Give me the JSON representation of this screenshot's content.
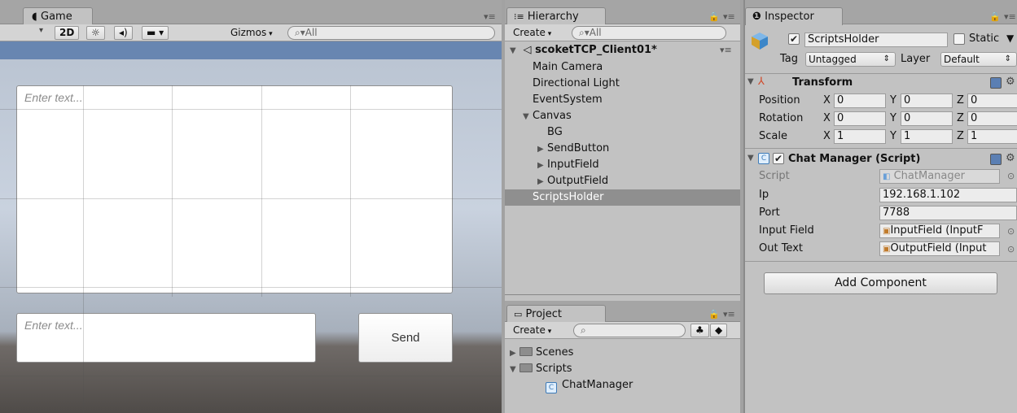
{
  "game": {
    "tab_label": "Game",
    "aspect_dropdown": "",
    "btn_2d": "2D",
    "gizmos_label": "Gizmos",
    "search_placeholder": "All",
    "output_placeholder": "Enter text...",
    "input_placeholder": "Enter text...",
    "send_label": "Send"
  },
  "hierarchy": {
    "tab_label": "Hierarchy",
    "create_label": "Create",
    "search_placeholder": "All",
    "scene_name": "scoketTCP_Client01*",
    "items": [
      {
        "label": "Main Camera",
        "indent": 1,
        "arrow": ""
      },
      {
        "label": "Directional Light",
        "indent": 1,
        "arrow": ""
      },
      {
        "label": "EventSystem",
        "indent": 1,
        "arrow": ""
      },
      {
        "label": "Canvas",
        "indent": 1,
        "arrow": "▼"
      },
      {
        "label": "BG",
        "indent": 2,
        "arrow": ""
      },
      {
        "label": "SendButton",
        "indent": 2,
        "arrow": "▶"
      },
      {
        "label": "InputField",
        "indent": 2,
        "arrow": "▶"
      },
      {
        "label": "OutputField",
        "indent": 2,
        "arrow": "▶"
      },
      {
        "label": "ScriptsHolder",
        "indent": 1,
        "arrow": "",
        "selected": true
      }
    ]
  },
  "project": {
    "tab_label": "Project",
    "create_label": "Create",
    "items": [
      {
        "label": "Scenes",
        "arrow": "▶",
        "icon": "folder-icon"
      },
      {
        "label": "Scripts",
        "arrow": "▼",
        "icon": "folder-icon"
      },
      {
        "label": "ChatManager",
        "arrow": "",
        "icon": "csharp-script-icon"
      }
    ]
  },
  "inspector": {
    "tab_label": "Inspector",
    "object_name": "ScriptsHolder",
    "static_label": "Static",
    "tag_label": "Tag",
    "tag_value": "Untagged",
    "layer_label": "Layer",
    "layer_value": "Default",
    "transform": {
      "title": "Transform",
      "rows": [
        {
          "label": "Position",
          "x": "0",
          "y": "0",
          "z": "0"
        },
        {
          "label": "Rotation",
          "x": "0",
          "y": "0",
          "z": "0"
        },
        {
          "label": "Scale",
          "x": "1",
          "y": "1",
          "z": "1"
        }
      ],
      "axis_x": "X",
      "axis_y": "Y",
      "axis_z": "Z"
    },
    "chat_manager": {
      "title": "Chat Manager (Script)",
      "script_label": "Script",
      "script_value": "ChatManager",
      "ip_label": "Ip",
      "ip_value": "192.168.1.102",
      "port_label": "Port",
      "port_value": "7788",
      "input_field_label": "Input Field",
      "input_field_value": "InputField (InputF",
      "out_text_label": "Out Text",
      "out_text_value": "OutputField (Input"
    },
    "add_component_label": "Add Component"
  },
  "colors": {
    "panel_bg": "#c2c2c2",
    "selected_row": "#8f8f8f",
    "game_header": "#6886b1"
  }
}
